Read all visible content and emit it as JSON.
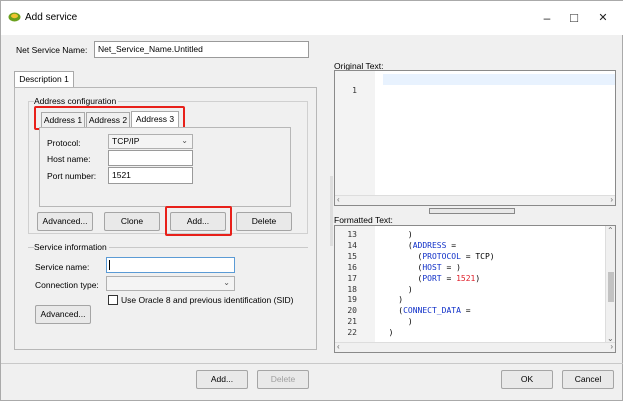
{
  "window": {
    "title": "Add service",
    "minimize": "–",
    "maximize": "□",
    "close": "✕"
  },
  "net_service": {
    "label": "Net Service Name:",
    "value": "Net_Service_Name.Untitled"
  },
  "description_tab": "Description 1",
  "address_config": {
    "title": "Address configuration",
    "tabs": [
      "Address 1",
      "Address 2",
      "Address 3"
    ],
    "active_tab": "Address 3",
    "protocol_label": "Protocol:",
    "protocol_value": "TCP/IP",
    "host_label": "Host name:",
    "host_value": "",
    "port_label": "Port number:",
    "port_value": "1521",
    "buttons": {
      "advanced": "Advanced...",
      "clone": "Clone",
      "add": "Add...",
      "delete": "Delete"
    }
  },
  "service_info": {
    "title": "Service information",
    "service_name_label": "Service name:",
    "service_name_value": "",
    "connection_type_label": "Connection type:",
    "connection_type_value": "",
    "oracle8_checkbox_label": "Use Oracle 8 and previous identification (SID)",
    "oracle8_checked": false,
    "advanced": "Advanced..."
  },
  "original_text": {
    "label": "Original Text:",
    "lines": [
      {
        "n": "1",
        "text": ""
      }
    ]
  },
  "formatted_text": {
    "label": "Formatted Text:",
    "lines": [
      {
        "n": "13",
        "parts": [
          {
            "t": "      )",
            "c": ""
          }
        ]
      },
      {
        "n": "14",
        "parts": [
          {
            "t": "      (",
            "c": ""
          },
          {
            "t": "ADDRESS",
            "c": "kw"
          },
          {
            "t": " =",
            "c": ""
          }
        ]
      },
      {
        "n": "15",
        "parts": [
          {
            "t": "        (",
            "c": ""
          },
          {
            "t": "PROTOCOL",
            "c": "kw"
          },
          {
            "t": " = TCP)",
            "c": ""
          }
        ]
      },
      {
        "n": "16",
        "parts": [
          {
            "t": "        (",
            "c": ""
          },
          {
            "t": "HOST",
            "c": "kw"
          },
          {
            "t": " = )",
            "c": ""
          }
        ]
      },
      {
        "n": "17",
        "parts": [
          {
            "t": "        (",
            "c": ""
          },
          {
            "t": "PORT",
            "c": "kw"
          },
          {
            "t": " = ",
            "c": ""
          },
          {
            "t": "1521",
            "c": "num"
          },
          {
            "t": ")",
            "c": ""
          }
        ]
      },
      {
        "n": "18",
        "parts": [
          {
            "t": "      )",
            "c": ""
          }
        ]
      },
      {
        "n": "19",
        "parts": [
          {
            "t": "    )",
            "c": ""
          }
        ]
      },
      {
        "n": "20",
        "parts": [
          {
            "t": "    (",
            "c": ""
          },
          {
            "t": "CONNECT_DATA",
            "c": "kw"
          },
          {
            "t": " =",
            "c": ""
          }
        ]
      },
      {
        "n": "21",
        "parts": [
          {
            "t": "      )",
            "c": ""
          }
        ]
      },
      {
        "n": "22",
        "parts": [
          {
            "t": "  )",
            "c": ""
          }
        ]
      }
    ]
  },
  "bottom_buttons": {
    "add": "Add...",
    "delete": "Delete",
    "ok": "OK",
    "cancel": "Cancel"
  },
  "colors": {
    "highlight": "#e8201a",
    "keyword": "#1030c8",
    "number": "#e0202a"
  }
}
